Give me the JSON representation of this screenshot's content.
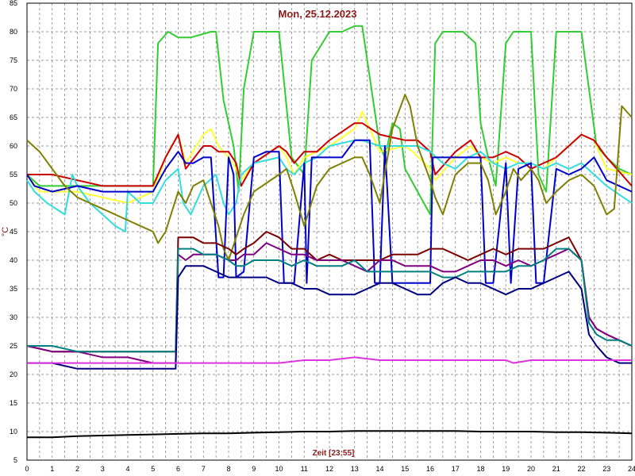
{
  "chart_data": {
    "type": "line",
    "title": "Mon, 25.12.2023",
    "xlabel": "Zeit [23:55]",
    "ylabel": "°C",
    "xlim": [
      0,
      24
    ],
    "ylim": [
      5,
      85
    ],
    "x_ticks": [
      0,
      1,
      2,
      3,
      4,
      5,
      6,
      7,
      8,
      9,
      10,
      11,
      12,
      13,
      14,
      15,
      16,
      17,
      18,
      19,
      20,
      21,
      22,
      23,
      24
    ],
    "y_ticks": [
      5,
      10,
      15,
      20,
      25,
      30,
      35,
      40,
      45,
      50,
      55,
      60,
      65,
      70,
      75,
      80,
      85
    ],
    "grid": true,
    "series": [
      {
        "color": "#33cc33",
        "x": [
          0,
          0.5,
          1.5,
          2,
          3,
          4,
          5,
          5.2,
          5.6,
          6,
          6.5,
          7.3,
          7.5,
          7.8,
          8,
          8.2,
          8.4,
          8.6,
          9,
          9.3,
          10,
          10.5,
          11,
          11.3,
          12,
          12.5,
          13,
          13.3,
          13.8,
          14,
          14.2,
          14.5,
          14.8,
          15,
          15.5,
          16,
          16.2,
          16.5,
          17,
          17.3,
          17.8,
          18,
          18.3,
          18.6,
          19,
          19.3,
          20,
          20.3,
          20.6,
          21,
          21.3,
          21.6,
          22,
          22.3,
          22.6,
          23,
          23.5,
          24
        ],
        "y": [
          55,
          53,
          53,
          53,
          53,
          53,
          53,
          78,
          80,
          79,
          79,
          80,
          80,
          68,
          64,
          60,
          52,
          70,
          80,
          80,
          80,
          58,
          55,
          75,
          80,
          80,
          81,
          81,
          66,
          60,
          58,
          64,
          63,
          56,
          52,
          48,
          78,
          80,
          80,
          80,
          78,
          64,
          58,
          53,
          78,
          80,
          80,
          55,
          52,
          80,
          80,
          80,
          80,
          70,
          60,
          58,
          56,
          55
        ]
      },
      {
        "color": "#ffff33",
        "x": [
          0,
          0.5,
          1,
          2,
          3,
          4,
          5,
          5.5,
          6,
          6.3,
          7,
          7.3,
          7.6,
          8,
          8.3,
          8.5,
          9,
          10,
          10.3,
          10.6,
          11,
          11.5,
          12,
          13,
          13.3,
          14,
          15,
          15.3,
          16,
          16.2,
          16.6,
          17,
          17.6,
          18,
          18.5,
          19,
          19.5,
          20,
          20.5,
          21,
          21.5,
          22,
          22.5,
          23,
          24
        ],
        "y": [
          55,
          52,
          52,
          52,
          51,
          50,
          52,
          58,
          62,
          57,
          62,
          63,
          60,
          58,
          56,
          54,
          57,
          60,
          58,
          55,
          58,
          59,
          60,
          63,
          66,
          59,
          60,
          59,
          56,
          54,
          56,
          58,
          60,
          58,
          57,
          58,
          57,
          57,
          56,
          58,
          60,
          62,
          61,
          56,
          55
        ]
      },
      {
        "color": "#cc0000",
        "x": [
          0,
          1,
          2,
          3,
          4,
          5,
          5.5,
          6,
          6.3,
          7,
          7.3,
          7.6,
          8,
          8.3,
          8.5,
          9,
          10,
          10.3,
          10.6,
          11,
          11.5,
          12,
          13,
          13.3,
          14,
          15,
          15.5,
          16,
          16.2,
          16.6,
          17,
          17.6,
          18,
          18.5,
          19,
          19.5,
          20,
          20.5,
          21,
          21.5,
          22,
          22.5,
          23,
          24
        ],
        "y": [
          55,
          55,
          54,
          53,
          53,
          53,
          58,
          62,
          56,
          60,
          60,
          59,
          59,
          57,
          53,
          57,
          60,
          59,
          57,
          59,
          59,
          61,
          64,
          64,
          62,
          61,
          61,
          59,
          55,
          57,
          59,
          61,
          58,
          58,
          59,
          58,
          56,
          57,
          58,
          60,
          62,
          61,
          58,
          53
        ]
      },
      {
        "color": "#33dddd",
        "x": [
          0,
          0.3,
          0.8,
          1.5,
          1.8,
          2,
          2.5,
          3,
          3.5,
          3.9,
          4,
          4.5,
          5,
          5.5,
          6,
          6.2,
          6.5,
          7,
          7.5,
          7.8,
          8,
          8.3,
          8.5,
          9,
          10,
          10.3,
          10.6,
          11,
          11.5,
          12,
          13,
          13.3,
          14,
          15,
          15.5,
          16,
          16.5,
          17,
          17.5,
          18,
          18.5,
          19,
          19.5,
          20,
          20.5,
          21,
          21.5,
          22,
          22.5,
          23,
          24
        ],
        "y": [
          54,
          52,
          50,
          48,
          55,
          53,
          50,
          48,
          46,
          45,
          52,
          50,
          50,
          54,
          56,
          50,
          48,
          53,
          55,
          50,
          48,
          50,
          55,
          57,
          58,
          56,
          55,
          57,
          58,
          60,
          61,
          61,
          60,
          60,
          60,
          59,
          57,
          56,
          58,
          59,
          57,
          56,
          57,
          57,
          56,
          57,
          56,
          57,
          55,
          53,
          50
        ]
      },
      {
        "color": "#0000cc",
        "x": [
          0,
          0.3,
          1,
          2,
          3,
          4,
          5,
          5.5,
          6,
          6.3,
          6.6,
          7,
          7.3,
          7.6,
          7.8,
          8,
          8.2,
          8.3,
          8.6,
          9,
          9.5,
          10,
          10.2,
          10.6,
          11,
          11.1,
          11.3,
          12,
          12.5,
          13,
          13.2,
          13.6,
          13.8,
          14,
          14.2,
          14.5,
          15,
          15.5,
          16,
          16.1,
          16.4,
          17,
          17.5,
          18,
          18.2,
          18.5,
          19,
          19.2,
          19.5,
          20,
          20.2,
          20.5,
          21,
          21.5,
          22,
          22.5,
          23,
          24
        ],
        "y": [
          55,
          53,
          52,
          53,
          52,
          52,
          52,
          56,
          59,
          57,
          57,
          58,
          58,
          37,
          37,
          58,
          55,
          37,
          38,
          58,
          59,
          59,
          36,
          36,
          57,
          36,
          58,
          58,
          58,
          61,
          61,
          61,
          36,
          36,
          60,
          36,
          36,
          36,
          36,
          58,
          58,
          58,
          58,
          58,
          36,
          36,
          57,
          36,
          56,
          57,
          36,
          36,
          56,
          55,
          56,
          58,
          54,
          52
        ]
      },
      {
        "color": "#808000",
        "x": [
          0,
          0.5,
          1,
          1.5,
          2,
          3,
          4,
          4.5,
          5,
          5.2,
          5.5,
          6,
          6.3,
          6.6,
          7,
          7.3,
          7.6,
          7.8,
          8,
          8.3,
          8.6,
          9,
          10,
          10.3,
          10.6,
          11,
          11.5,
          12,
          13,
          13.3,
          13.6,
          14,
          14.5,
          15,
          15.2,
          15.5,
          16,
          16.2,
          16.5,
          17,
          17.5,
          18,
          18.3,
          18.6,
          19,
          19.3,
          19.6,
          20,
          20.3,
          20.6,
          21,
          21.5,
          22,
          22.5,
          22.8,
          23,
          23.3,
          23.6,
          24
        ],
        "y": [
          61,
          59,
          56,
          53,
          51,
          49,
          47,
          46,
          45,
          43,
          45,
          52,
          50,
          53,
          54,
          50,
          46,
          42,
          40,
          44,
          48,
          52,
          55,
          56,
          52,
          46,
          53,
          56,
          58,
          58,
          55,
          50,
          63,
          69,
          67,
          60,
          54,
          51,
          48,
          55,
          57,
          57,
          54,
          48,
          52,
          56,
          54,
          56,
          54,
          50,
          52,
          54,
          55,
          53,
          50,
          48,
          49,
          67,
          65
        ]
      },
      {
        "color": "#7a0000",
        "x": [
          0,
          1,
          2,
          3,
          4,
          5,
          5.9,
          6,
          6.3,
          6.6,
          7,
          7.5,
          8,
          8.3,
          8.6,
          9,
          9.5,
          10,
          10.5,
          11,
          11.5,
          12,
          12.5,
          13,
          13.5,
          14,
          14.5,
          15,
          15.5,
          16,
          16.5,
          17,
          17.5,
          18,
          18.5,
          19,
          19.5,
          20,
          20.5,
          21,
          21.5,
          22,
          22.3,
          22.6,
          23,
          23.5,
          24
        ],
        "y": [
          25,
          24,
          24,
          24,
          24,
          24,
          24,
          44,
          44,
          44,
          43,
          43,
          42,
          41,
          42,
          43,
          45,
          44,
          42,
          42,
          40,
          41,
          40,
          40,
          40,
          40,
          41,
          41,
          41,
          42,
          42,
          41,
          40,
          41,
          42,
          41,
          42,
          42,
          42,
          43,
          44,
          40,
          30,
          28,
          27,
          26,
          25
        ]
      },
      {
        "color": "#800080",
        "x": [
          0,
          1,
          2,
          3,
          4,
          5,
          5.9,
          6,
          6.3,
          6.6,
          7,
          7.5,
          8,
          8.3,
          8.6,
          9,
          9.5,
          10,
          10.5,
          11,
          11.5,
          12,
          12.5,
          13,
          13.5,
          14,
          14.5,
          15,
          15.5,
          16,
          16.5,
          17,
          17.5,
          18,
          18.5,
          19,
          19.5,
          20,
          20.5,
          21,
          21.5,
          22,
          22.3,
          22.6,
          23,
          23.5,
          24
        ],
        "y": [
          25,
          24,
          24,
          23,
          23,
          22,
          22,
          41,
          40,
          41,
          41,
          41,
          40,
          40,
          41,
          41,
          43,
          42,
          41,
          41,
          40,
          40,
          40,
          39,
          38,
          40,
          40,
          39,
          39,
          39,
          38,
          38,
          39,
          40,
          40,
          39,
          40,
          39,
          40,
          41,
          42,
          40,
          30,
          28,
          27,
          26,
          25
        ]
      },
      {
        "color": "#008080",
        "x": [
          0,
          1,
          2,
          3,
          4,
          5,
          5.9,
          6,
          6.3,
          6.6,
          7,
          7.5,
          8,
          8.3,
          8.6,
          9,
          9.5,
          10,
          10.5,
          11,
          11.5,
          12,
          12.5,
          13,
          13.5,
          14,
          14.5,
          15,
          15.5,
          16,
          16.5,
          17,
          17.5,
          18,
          18.5,
          19,
          19.5,
          20,
          20.5,
          21,
          21.5,
          22,
          22.3,
          22.6,
          23,
          23.5,
          24
        ],
        "y": [
          25,
          25,
          24,
          24,
          24,
          24,
          24,
          42,
          42,
          42,
          41,
          41,
          40,
          39,
          39,
          40,
          40,
          40,
          39,
          40,
          39,
          39,
          39,
          40,
          38,
          38,
          38,
          38,
          38,
          38,
          37,
          37,
          38,
          38,
          38,
          38,
          39,
          39,
          40,
          42,
          42,
          40,
          29,
          27,
          26,
          26,
          25
        ]
      },
      {
        "color": "#000080",
        "x": [
          0,
          1,
          2,
          3,
          4,
          5,
          5.9,
          6,
          6.3,
          6.6,
          7,
          7.5,
          8,
          8.3,
          8.6,
          9,
          9.5,
          10,
          10.5,
          11,
          11.5,
          12,
          12.5,
          13,
          13.5,
          14,
          14.5,
          15,
          15.5,
          16,
          16.5,
          17,
          17.5,
          18,
          18.5,
          19,
          19.5,
          20,
          20.5,
          21,
          21.5,
          22,
          22.3,
          22.6,
          23,
          23.5,
          24
        ],
        "y": [
          22,
          22,
          21,
          21,
          21,
          21,
          21,
          37,
          39,
          39,
          39,
          38,
          37,
          37,
          37,
          37,
          37,
          36,
          36,
          35,
          35,
          34,
          34,
          34,
          35,
          36,
          36,
          35,
          34,
          34,
          36,
          37,
          36,
          36,
          35,
          34,
          35,
          35,
          36,
          37,
          38,
          35,
          27,
          25,
          23,
          22,
          22
        ]
      },
      {
        "color": "#dd33dd",
        "x": [
          0,
          1,
          2,
          3,
          4,
          5,
          5.9,
          6,
          7,
          8,
          9,
          10,
          11,
          12,
          13,
          14,
          15,
          16,
          17,
          18,
          19,
          19.3,
          20,
          21,
          22,
          23,
          24
        ],
        "y": [
          22,
          22,
          22,
          22,
          22,
          22,
          22,
          22,
          22,
          22,
          22,
          22,
          22.5,
          22.5,
          23,
          22.5,
          22.5,
          22.5,
          22.5,
          22.5,
          22.5,
          22,
          22.5,
          22.5,
          22.5,
          22.5,
          22.5
        ]
      },
      {
        "color": "#000000",
        "x": [
          0,
          1,
          2,
          3,
          4,
          5,
          6,
          7,
          8,
          9,
          10,
          11,
          12,
          13,
          14,
          15,
          16,
          17,
          18,
          19,
          20,
          21,
          22,
          23,
          24
        ],
        "y": [
          9,
          9,
          9.2,
          9.3,
          9.4,
          9.5,
          9.6,
          9.7,
          9.7,
          9.8,
          9.9,
          10,
          10,
          10.1,
          10.1,
          10.1,
          10.1,
          10.1,
          10,
          10,
          10,
          9.9,
          9.9,
          9.8,
          9.7
        ]
      }
    ]
  }
}
